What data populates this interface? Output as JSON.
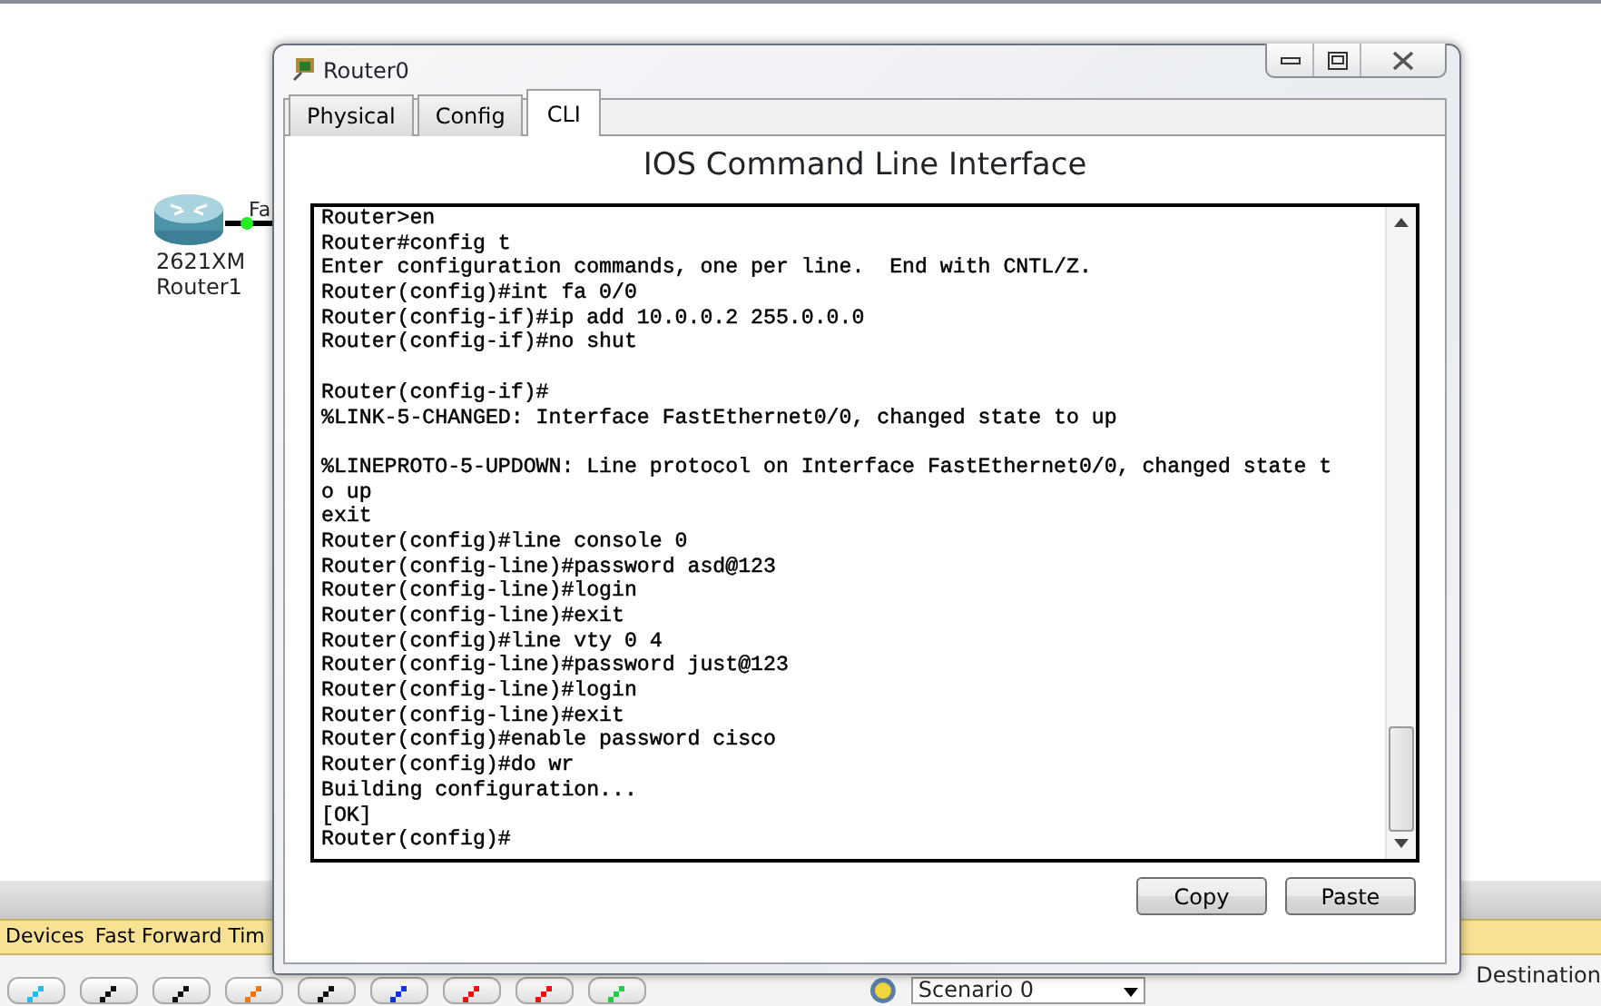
{
  "workspace": {
    "device": {
      "model": "2621XM",
      "name": "Router1",
      "port_label": "Fa"
    }
  },
  "dialog": {
    "title": "Router0",
    "tabs": [
      {
        "label": "Physical",
        "selected": false
      },
      {
        "label": "Config",
        "selected": false
      },
      {
        "label": "CLI",
        "selected": true
      }
    ],
    "heading": "IOS Command Line Interface",
    "terminal": {
      "blocks": [
        [
          "Router>en",
          "Router#config t",
          "Enter configuration commands, one per line.  End with CNTL/Z.",
          "Router(config)#int fa 0/0",
          "Router(config-if)#ip add 10.0.0.2 255.0.0.0",
          "Router(config-if)#no shut"
        ],
        [
          "Router(config-if)#",
          "%LINK-5-CHANGED: Interface FastEthernet0/0, changed state to up"
        ],
        [
          "%LINEPROTO-5-UPDOWN: Line protocol on Interface FastEthernet0/0, changed state t",
          "o up",
          "exit",
          "Router(config)#line console 0",
          "Router(config-line)#password asd@123",
          "Router(config-line)#login",
          "Router(config-line)#exit",
          "Router(config)#line vty 0 4",
          "Router(config-line)#password just@123",
          "Router(config-line)#login",
          "Router(config-line)#exit",
          "Router(config)#enable password cisco",
          "Router(config)#do wr",
          "Building configuration...",
          "[OK]",
          "Router(config)#"
        ]
      ]
    },
    "buttons": [
      "Copy",
      "Paste"
    ]
  },
  "bottom_panel": {
    "bar_items": [
      "Devices",
      "Fast Forward Tim"
    ],
    "scenario": "Scenario 0",
    "column": "Destination",
    "connections": [
      {
        "color": "#22bbee"
      },
      {
        "color": "#111111"
      },
      {
        "color": "#111111"
      },
      {
        "color": "#ee7711"
      },
      {
        "color": "#111111"
      },
      {
        "color": "#1133dd"
      },
      {
        "color": "#ee1111"
      },
      {
        "color": "#ee1111"
      },
      {
        "color": "#22cc44"
      }
    ]
  }
}
